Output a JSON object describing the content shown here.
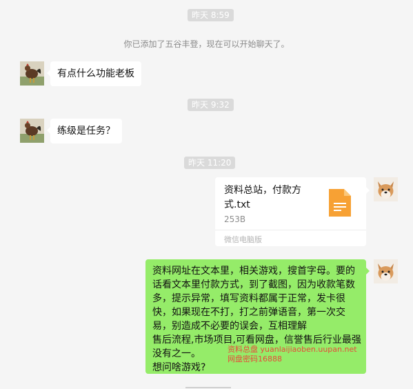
{
  "timestamps": [
    "昨天 8:59",
    "昨天 9:32",
    "昨天 11:20"
  ],
  "system_notice": "你已添加了五谷丰登，现在可以开始聊天了。",
  "incoming": [
    {
      "text": "有点什么功能老板"
    },
    {
      "text": "练级是任务？"
    }
  ],
  "file_message": {
    "name": "资料总站，付款方式.txt",
    "size": "253B",
    "source": "微信电脑版",
    "icon": "txt-file-icon"
  },
  "outgoing_text": {
    "lines": [
      "资料网址在文本里，相关游戏，搜首字母。要的",
      "话看文本里付款方式，到了截图，因为收款笔数",
      "多，提示异常，填写资料都属于正常，发卡很",
      "快，如果现在不打，打之前弹语音，第一次交",
      "易，别造成不必要的误会，互相理解",
      "售后流程,市场项目,可看网盘，信誉售后行业最强",
      "没有之一。",
      "想问啥游戏?"
    ],
    "overlay_lines": [
      "资料总盘   yuanlaijiaoben.uupan.net",
      "网盘密码16888"
    ]
  },
  "colors": {
    "background": "#f5f5f5",
    "outgoing_bubble": "#95ec69",
    "timestamp_bg": "#dadada",
    "file_icon": "#f7a134",
    "overlay_text": "#e84a3a"
  }
}
